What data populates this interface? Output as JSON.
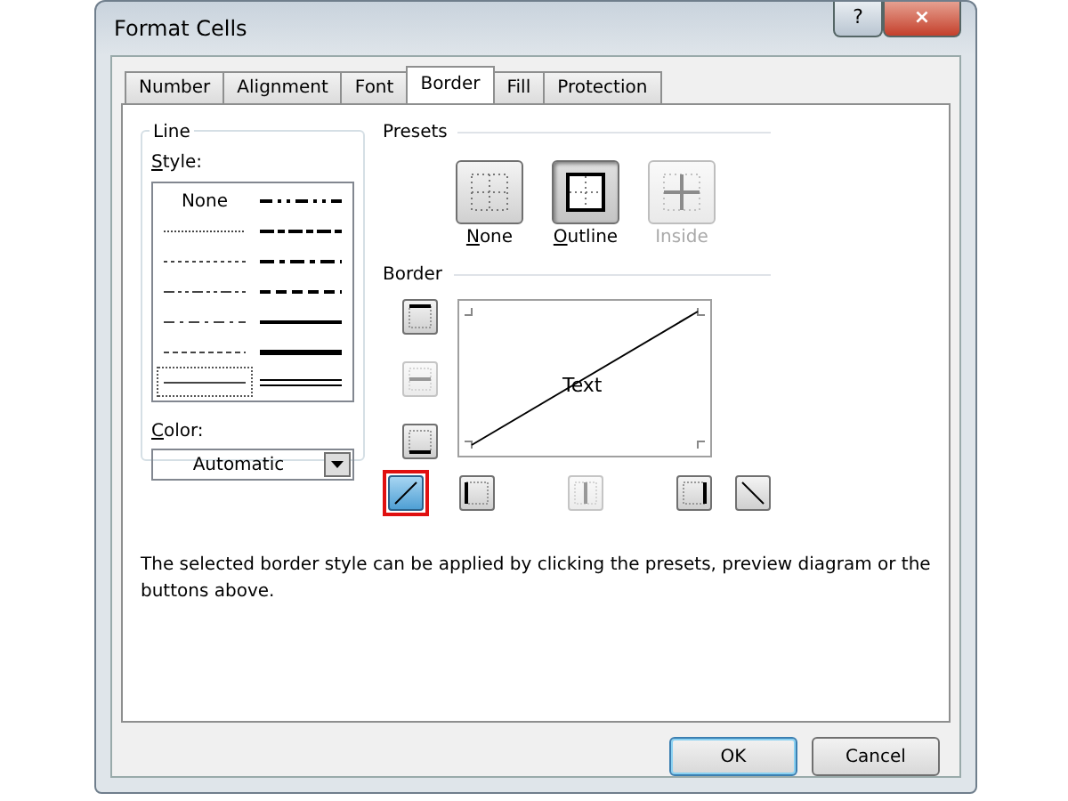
{
  "window": {
    "title": "Format Cells",
    "help_button": "?",
    "close_button": "×"
  },
  "tabs": [
    {
      "label": "Number",
      "selected": false
    },
    {
      "label": "Alignment",
      "selected": false
    },
    {
      "label": "Font",
      "selected": false
    },
    {
      "label": "Border",
      "selected": true
    },
    {
      "label": "Fill",
      "selected": false
    },
    {
      "label": "Protection",
      "selected": false
    }
  ],
  "line": {
    "title": "Line",
    "style_label": "Style:",
    "color_label": "Color:",
    "color_value": "Automatic",
    "styles": [
      {
        "kind": "none",
        "text": "None",
        "selected": false
      },
      {
        "kind": "hair",
        "selected": false
      },
      {
        "kind": "dotted",
        "selected": false
      },
      {
        "kind": "dashdotdot",
        "selected": false
      },
      {
        "kind": "dashdot",
        "selected": false
      },
      {
        "kind": "dashed",
        "selected": false
      },
      {
        "kind": "thin",
        "selected": true
      },
      {
        "kind": "mediumdashdotdot",
        "selected": false
      },
      {
        "kind": "slantdashdot",
        "selected": false
      },
      {
        "kind": "mediumdashdot",
        "selected": false
      },
      {
        "kind": "mediumdashed",
        "selected": false
      },
      {
        "kind": "medium",
        "selected": false
      },
      {
        "kind": "thick",
        "selected": false
      },
      {
        "kind": "double",
        "selected": false
      }
    ]
  },
  "presets": {
    "title": "Presets",
    "items": [
      {
        "kind": "none",
        "label": "None",
        "selected": false,
        "disabled": false
      },
      {
        "kind": "outline",
        "label": "Outline",
        "selected": true,
        "disabled": false
      },
      {
        "kind": "inside",
        "label": "Inside",
        "selected": false,
        "disabled": true
      }
    ]
  },
  "border": {
    "title": "Border",
    "preview_text": "Text",
    "side_buttons": [
      {
        "kind": "top",
        "selected": false,
        "disabled": false
      },
      {
        "kind": "middle",
        "selected": false,
        "disabled": true
      },
      {
        "kind": "bottom",
        "selected": false,
        "disabled": false
      }
    ],
    "bottom_buttons": [
      {
        "kind": "diagup",
        "selected": true,
        "disabled": false,
        "highlighted": true
      },
      {
        "kind": "left",
        "selected": false,
        "disabled": false,
        "highlighted": false
      },
      {
        "kind": "center",
        "selected": false,
        "disabled": true,
        "highlighted": false
      },
      {
        "kind": "right",
        "selected": false,
        "disabled": false,
        "highlighted": false
      },
      {
        "kind": "diagdown",
        "selected": false,
        "disabled": false,
        "highlighted": false
      }
    ]
  },
  "hint": "The selected border style can be applied by clicking the presets, preview diagram or the buttons above.",
  "buttons": [
    {
      "label": "OK",
      "kind": "default"
    },
    {
      "label": "Cancel",
      "kind": "normal"
    }
  ]
}
